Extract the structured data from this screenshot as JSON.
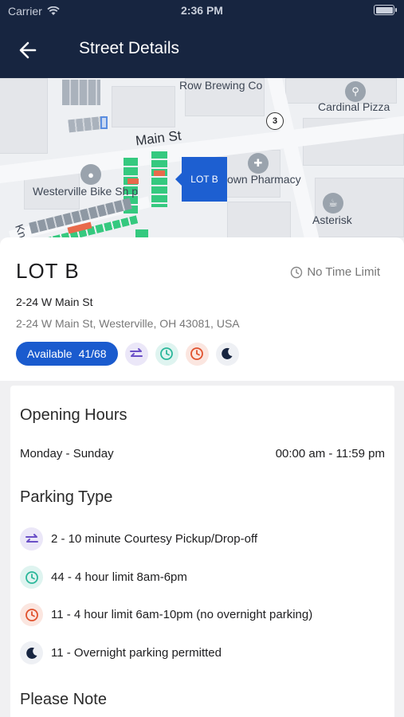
{
  "status_bar": {
    "carrier": "Carrier",
    "time": "2:36 PM"
  },
  "nav": {
    "title": "Street Details"
  },
  "map": {
    "street_label": "Main St",
    "route_shield": "3",
    "lot_marker": "LOT B",
    "pois": [
      {
        "label": "Row Brewing Co"
      },
      {
        "label": "Cardinal Pizza"
      },
      {
        "label": "own Pharmacy"
      },
      {
        "label": "Westerville Bike Sh p"
      },
      {
        "label": "Asterisk"
      },
      {
        "label": "Kn"
      }
    ]
  },
  "lot": {
    "name": "LOT B",
    "time_limit": "No Time Limit",
    "address_line": "2-24 W Main St",
    "full_address": "2-24 W Main St, Westerville, OH 43081, USA",
    "availability_label": "Available",
    "availability_count": "41/68"
  },
  "opening_hours": {
    "heading": "Opening Hours",
    "days": "Monday - Sunday",
    "hours": "00:00 am - 11:59 pm"
  },
  "parking_type": {
    "heading": "Parking Type",
    "items": [
      {
        "icon": "swap-icon",
        "text": "2 - 10 minute Courtesy Pickup/Drop-off"
      },
      {
        "icon": "clock-teal-icon",
        "text": "44 - 4 hour limit 8am-6pm"
      },
      {
        "icon": "clock-orange-icon",
        "text": "11 - 4 hour limit 6am-10pm (no overnight parking)"
      },
      {
        "icon": "moon-icon",
        "text": "11 - Overnight parking permitted"
      }
    ]
  },
  "please_note": {
    "heading": "Please Note"
  },
  "colors": {
    "nav_bg": "#172540",
    "accent_blue": "#1a5bce",
    "purple": "#6a4fc7",
    "teal": "#2bb79a",
    "orange": "#e0512d",
    "dark": "#172540"
  }
}
